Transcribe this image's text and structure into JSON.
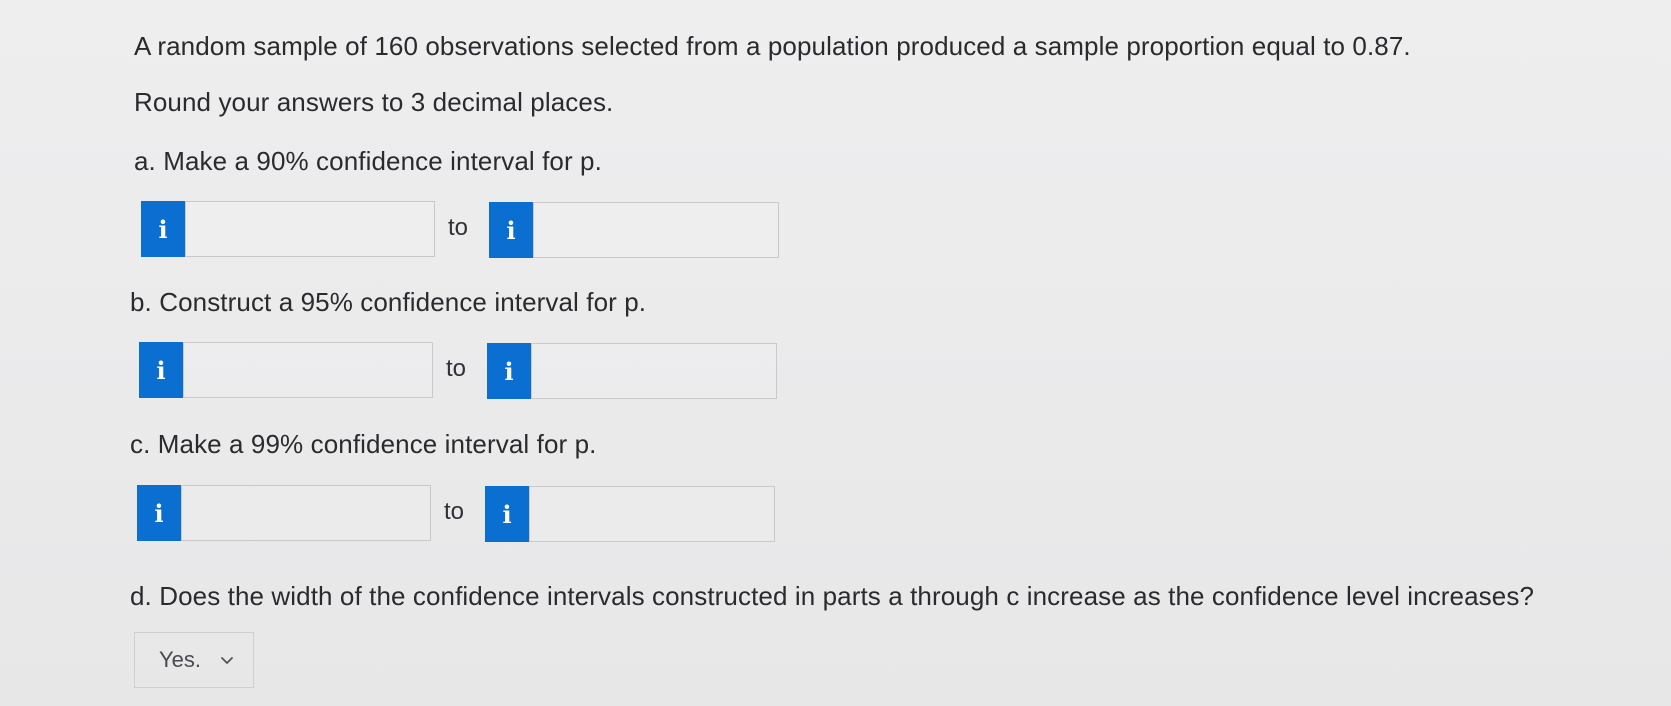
{
  "question": {
    "intro": "A random sample of 160 observations selected from a population produced a sample proportion equal to 0.87.",
    "instruction": "Round your answers to 3 decimal places."
  },
  "parts": {
    "a": {
      "prompt": "a. Make a 90% confidence interval for p.",
      "lower_value": "",
      "upper_value": "",
      "connector": "to",
      "info_icon": "i"
    },
    "b": {
      "prompt": "b. Construct a 95% confidence interval for p.",
      "lower_value": "",
      "upper_value": "",
      "connector": "to",
      "info_icon": "i"
    },
    "c": {
      "prompt": "c. Make a 99% confidence interval for p.",
      "lower_value": "",
      "upper_value": "",
      "connector": "to",
      "info_icon": "i"
    },
    "d": {
      "prompt": "d. Does the width of the confidence intervals constructed in parts a through c increase as the confidence level increases?",
      "selected_option": "Yes."
    }
  },
  "colors": {
    "info_badge": "#0a6fd1",
    "background": "#ebebec"
  }
}
